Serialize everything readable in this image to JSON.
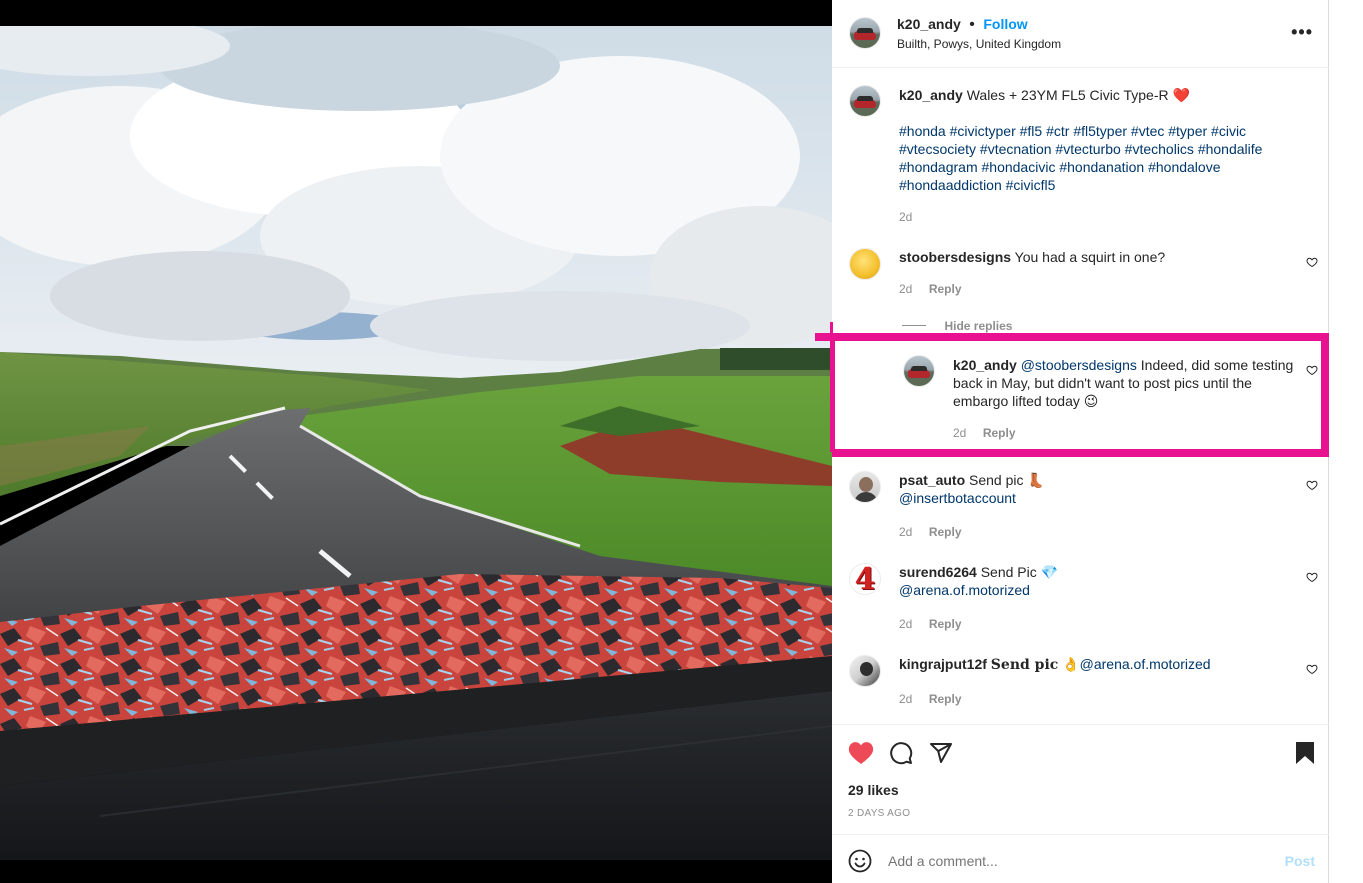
{
  "post": {
    "author": "k20_andy",
    "follow_label": "Follow",
    "separator": "•",
    "location": "Builth, Powys, United Kingdom",
    "more_label": "•••",
    "caption": {
      "username": "k20_andy",
      "text": "Wales + 23YM FL5 Civic Type-R",
      "emoji": "❤️",
      "hashtag_lines": [
        "#honda #civictyper #fl5 #ctr #fl5typer #vtec #typer #civic",
        "#vtecsociety #vtecnation #vtecturbo #vtecholics #hondalife",
        "#hondagram #hondacivic #hondanation #hondalove",
        "#hondaaddiction #civicfl5"
      ],
      "time": "2d"
    }
  },
  "comments": [
    {
      "username": "stoobersdesigns",
      "text": "You had a squirt in one?",
      "time": "2d",
      "reply_label": "Reply",
      "hide_replies_label": "Hide replies"
    },
    {
      "username": "k20_andy",
      "mention": "@stoobersdesigns",
      "line1": "Indeed, did some testing",
      "line2": "back in May, but didn't want to post pics until the",
      "line3": "embargo lifted today",
      "emoji": "😉",
      "time": "2d",
      "reply_label": "Reply"
    },
    {
      "username": "psat_auto",
      "text": "Send pic",
      "emoji": "👢",
      "mention": "@insertbotaccount",
      "time": "2d",
      "reply_label": "Reply"
    },
    {
      "username": "surend6264",
      "text": "Send Pic",
      "emoji": "💎",
      "mention": "@arena.of.motorized",
      "avatar_text": "4",
      "time": "2d",
      "reply_label": "Reply"
    },
    {
      "username": "kingrajput12f",
      "text": "Send pic",
      "emoji": "👌",
      "mention": "@arena.of.motorized",
      "time": "2d",
      "reply_label": "Reply"
    }
  ],
  "actions": {
    "likes": "29 likes",
    "date": "2 DAYS AGO"
  },
  "composer": {
    "placeholder": "Add a comment...",
    "post_label": "Post"
  },
  "colors": {
    "accent": "#0095f6",
    "highlight": "#e8118f",
    "like_red": "#ed4956"
  }
}
